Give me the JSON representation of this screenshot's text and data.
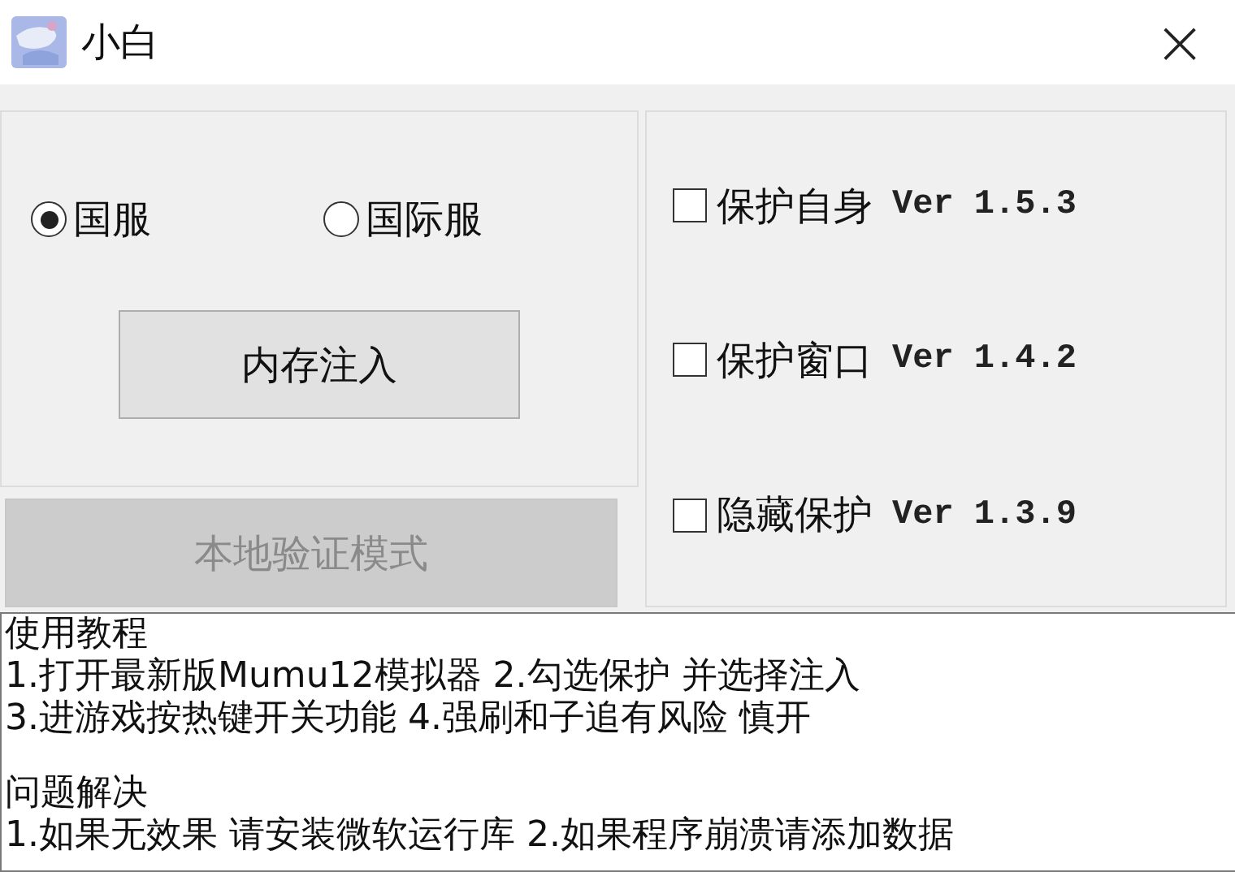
{
  "window": {
    "title": "小白",
    "close": "×"
  },
  "region": {
    "options": [
      {
        "label": "国服",
        "selected": true
      },
      {
        "label": "国际服",
        "selected": false
      }
    ]
  },
  "inject_button": {
    "label": "内存注入",
    "disabled": false
  },
  "local_button": {
    "label": "本地验证模式",
    "disabled": true
  },
  "protections": [
    {
      "label": "保护自身",
      "version": "Ver 1.5.3",
      "checked": false
    },
    {
      "label": "保护窗口",
      "version": "Ver 1.4.2",
      "checked": false
    },
    {
      "label": "隐藏保护",
      "version": "Ver 1.3.9",
      "checked": false
    }
  ],
  "notes": [
    {
      "heading": "使用教程",
      "lines": [
        "1.打开最新版Mumu12模拟器 2.勾选保护 并选择注入",
        "3.进游戏按热键开关功能 4.强刷和子追有风险 慎开"
      ]
    },
    {
      "heading": "问题解决",
      "lines": [
        "1.如果无效果 请安装微软运行库 2.如果程序崩溃请添加数据"
      ]
    }
  ]
}
